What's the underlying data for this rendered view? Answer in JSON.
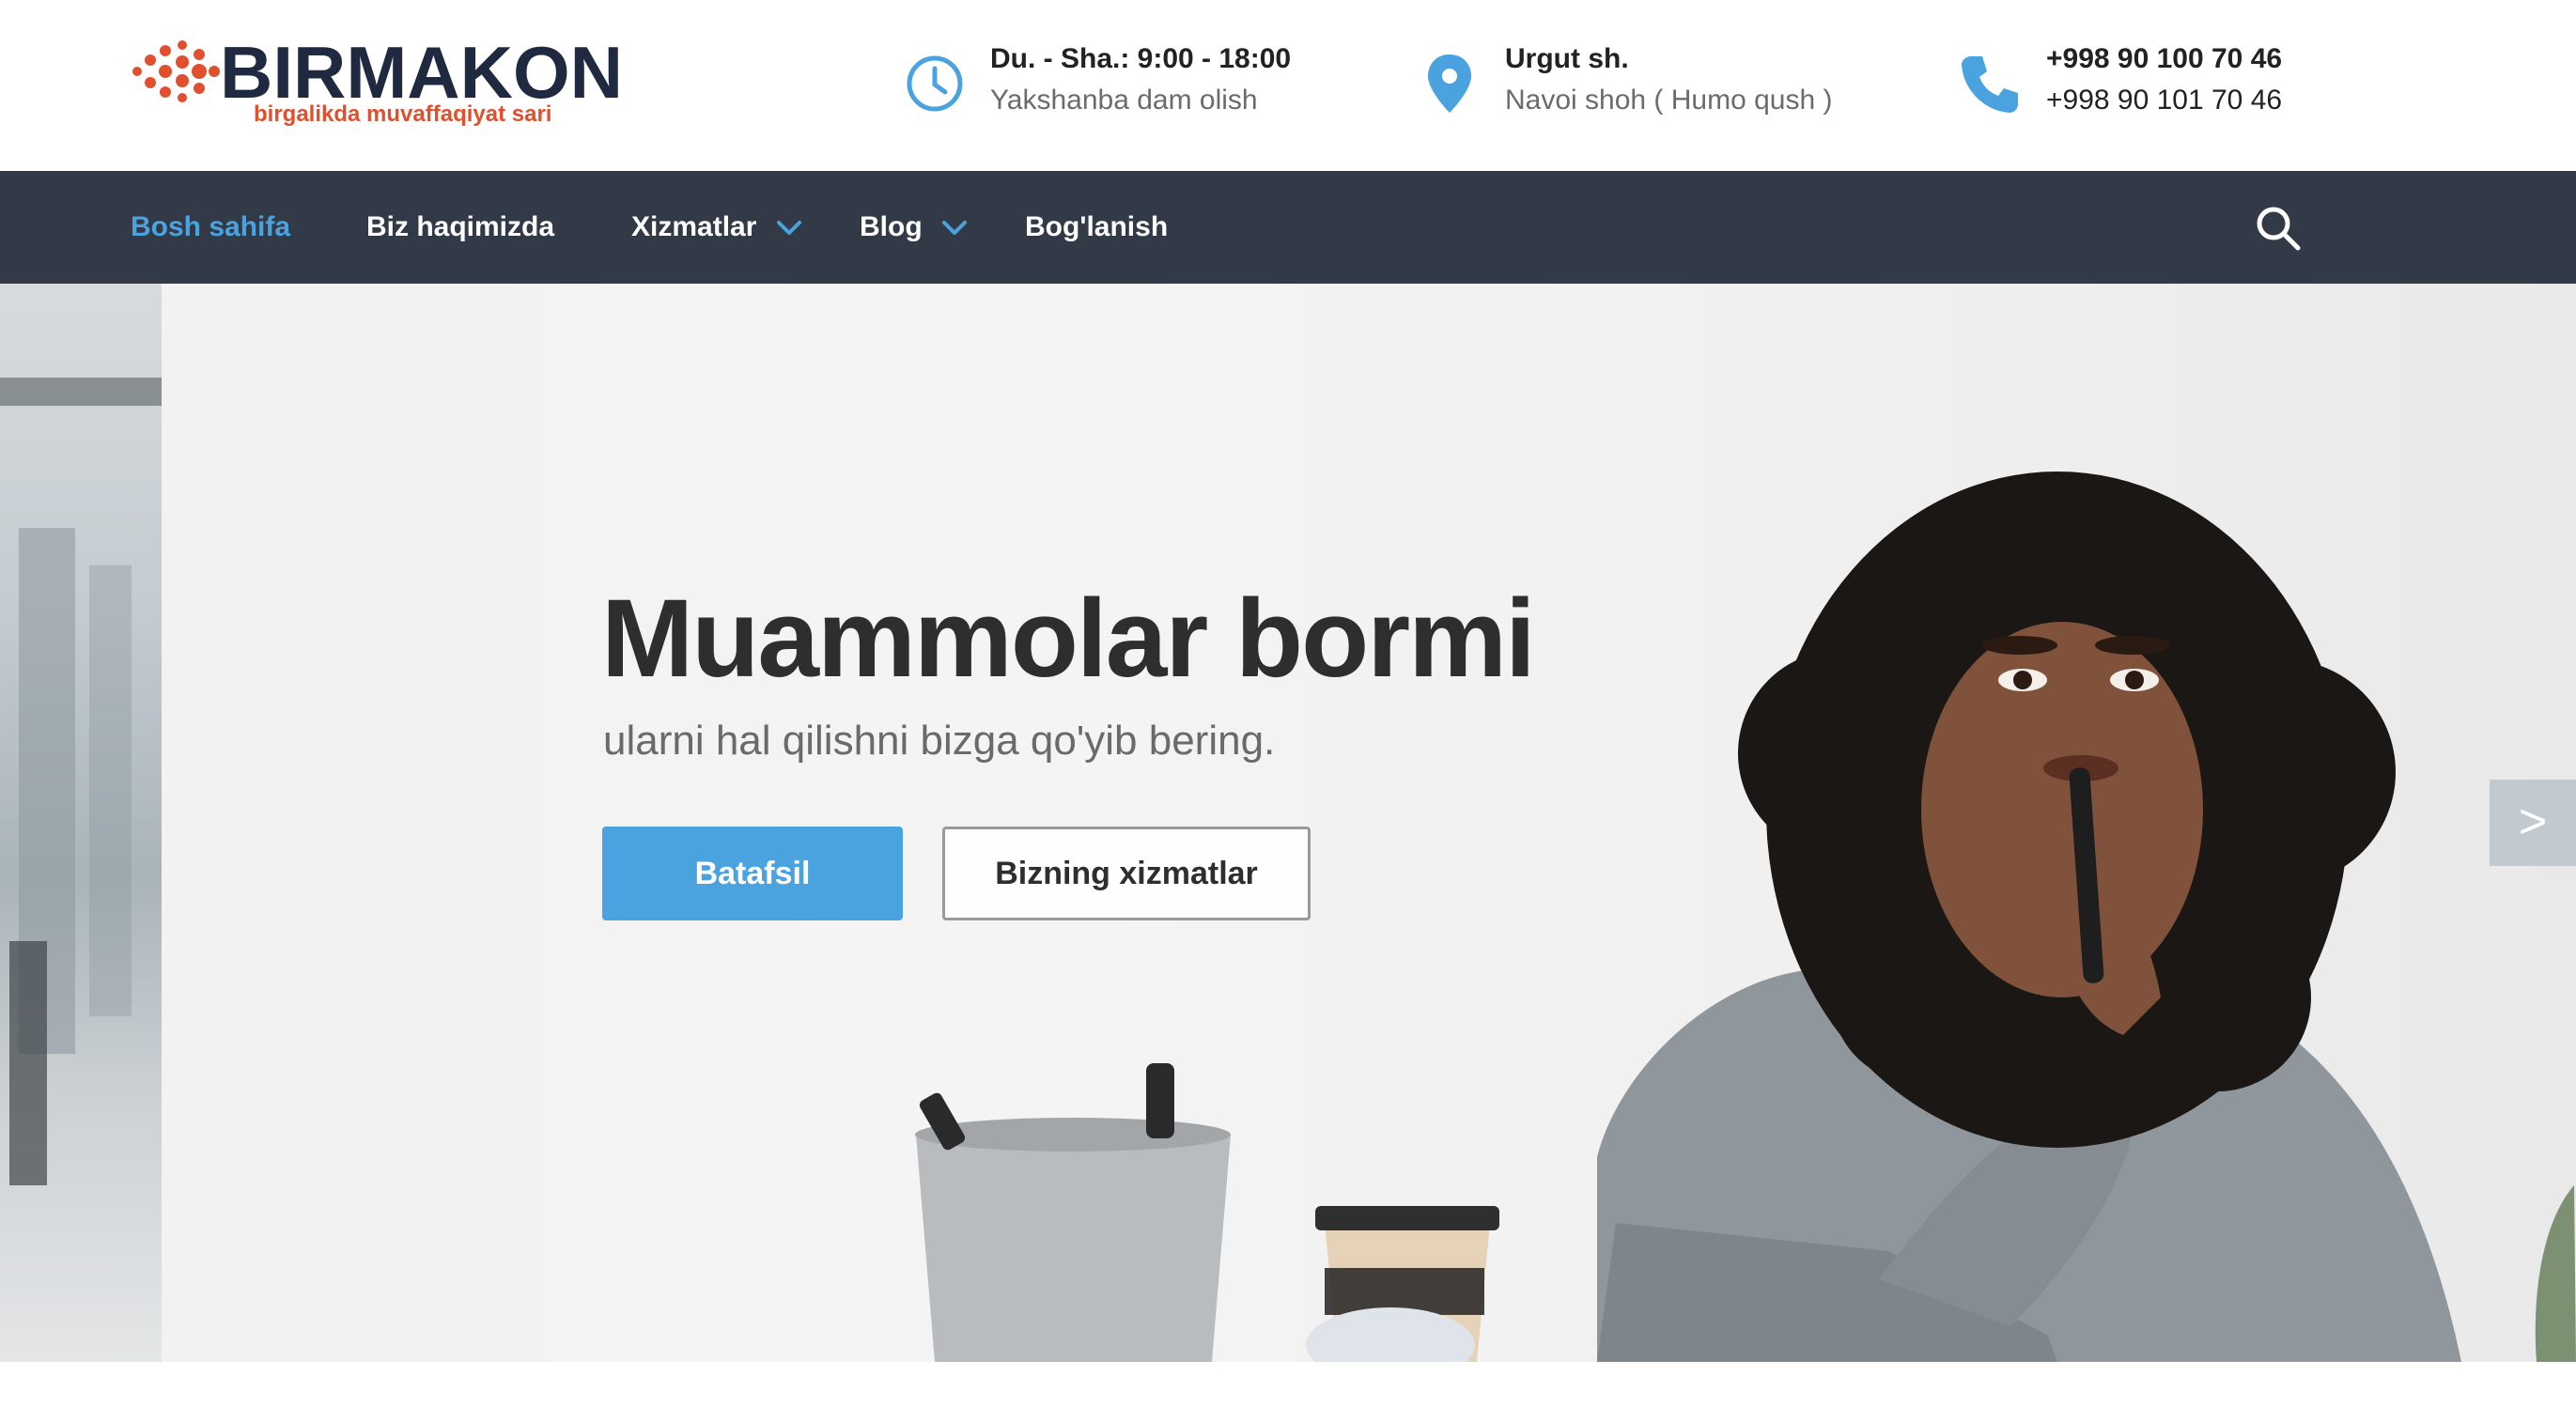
{
  "brand": {
    "name": "BIRMAKON",
    "tagline": "birgalikda muvaffaqiyat sari",
    "primary_color": "#1f2940",
    "accent_color": "#e0502e"
  },
  "contact": {
    "hours": {
      "icon": "clock-icon",
      "line1": "Du. - Sha.: 9:00 - 18:00",
      "line2": "Yakshanba dam olish"
    },
    "address": {
      "icon": "map-pin-icon",
      "line1": "Urgut sh.",
      "line2": "Navoi shoh ( Humo qush )"
    },
    "phone": {
      "icon": "phone-icon",
      "line1": "+998  90 100 70 46",
      "line2": "+998  90 101 70 46"
    },
    "icon_color": "#4aa3df"
  },
  "nav": {
    "items": [
      {
        "label": "Bosh sahifa",
        "active": true,
        "dropdown": false
      },
      {
        "label": "Biz haqimizda",
        "active": false,
        "dropdown": false
      },
      {
        "label": "Xizmatlar",
        "active": false,
        "dropdown": true
      },
      {
        "label": "Blog",
        "active": false,
        "dropdown": true
      },
      {
        "label": "Bog'lanish",
        "active": false,
        "dropdown": false
      }
    ],
    "search_icon": "search-icon",
    "background": "#333a47",
    "active_color": "#4aa3df"
  },
  "hero": {
    "title": "Muammolar bormi",
    "subtitle": "ularni hal qilishni bizga qo'yib bering.",
    "primary_button": "Batafsil",
    "secondary_button": "Bizning xizmatlar",
    "next_arrow": ">"
  }
}
